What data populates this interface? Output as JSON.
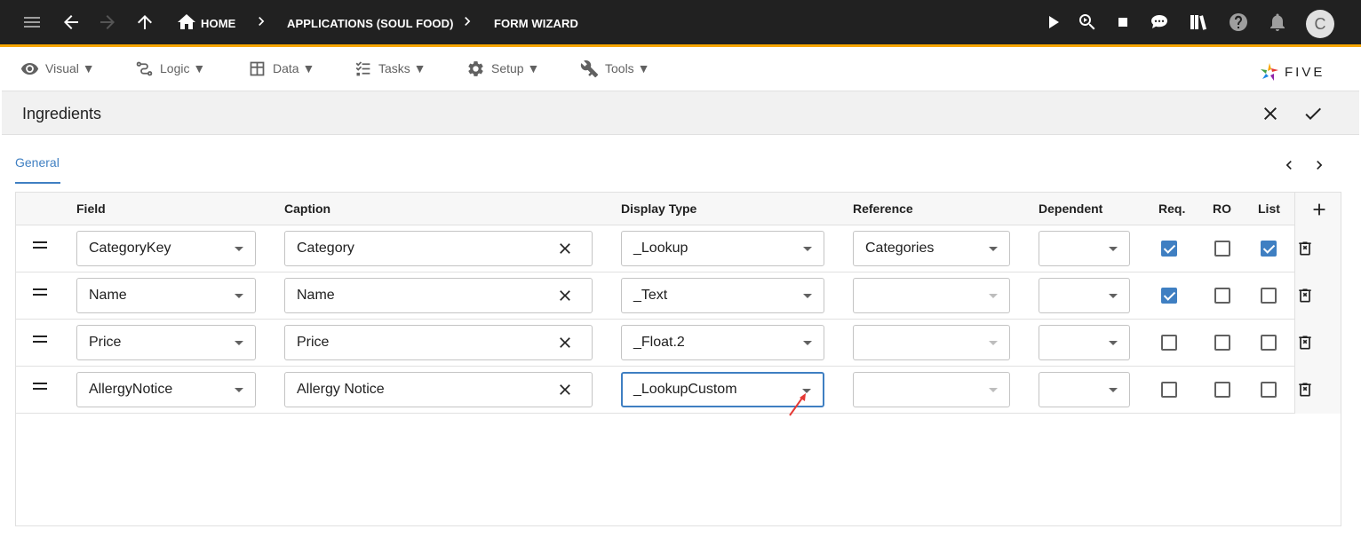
{
  "header": {
    "breadcrumbs": [
      "HOME",
      "APPLICATIONS (SOUL FOOD)",
      "FORM WIZARD"
    ],
    "avatar_initial": "C",
    "accent_color": "#f7a600",
    "bar_color": "#212121"
  },
  "menu": {
    "items": [
      {
        "label": "Visual ▼",
        "icon": "eye-icon"
      },
      {
        "label": "Logic ▼",
        "icon": "logic-icon"
      },
      {
        "label": "Data ▼",
        "icon": "table-icon"
      },
      {
        "label": "Tasks ▼",
        "icon": "checklist-icon"
      },
      {
        "label": "Setup ▼",
        "icon": "gear-icon"
      },
      {
        "label": "Tools ▼",
        "icon": "tools-icon"
      }
    ],
    "logo_text": "FIVE"
  },
  "form": {
    "title": "Ingredients",
    "tab": "General"
  },
  "table": {
    "columns": {
      "field": "Field",
      "caption": "Caption",
      "display_type": "Display Type",
      "reference": "Reference",
      "dependent": "Dependent",
      "req": "Req.",
      "ro": "RO",
      "list": "List"
    },
    "rows": [
      {
        "field": "CategoryKey",
        "caption": "Category",
        "display_type": "_Lookup",
        "reference": "Categories",
        "dependent": "",
        "req": true,
        "ro": false,
        "list": true
      },
      {
        "field": "Name",
        "caption": "Name",
        "display_type": "_Text",
        "reference": "",
        "dependent": "",
        "req": true,
        "ro": false,
        "list": false
      },
      {
        "field": "Price",
        "caption": "Price",
        "display_type": "_Float.2",
        "reference": "",
        "dependent": "",
        "req": false,
        "ro": false,
        "list": false
      },
      {
        "field": "AllergyNotice",
        "caption": "Allergy Notice",
        "display_type": "_LookupCustom",
        "reference": "",
        "dependent": "",
        "req": false,
        "ro": false,
        "list": false
      }
    ]
  }
}
